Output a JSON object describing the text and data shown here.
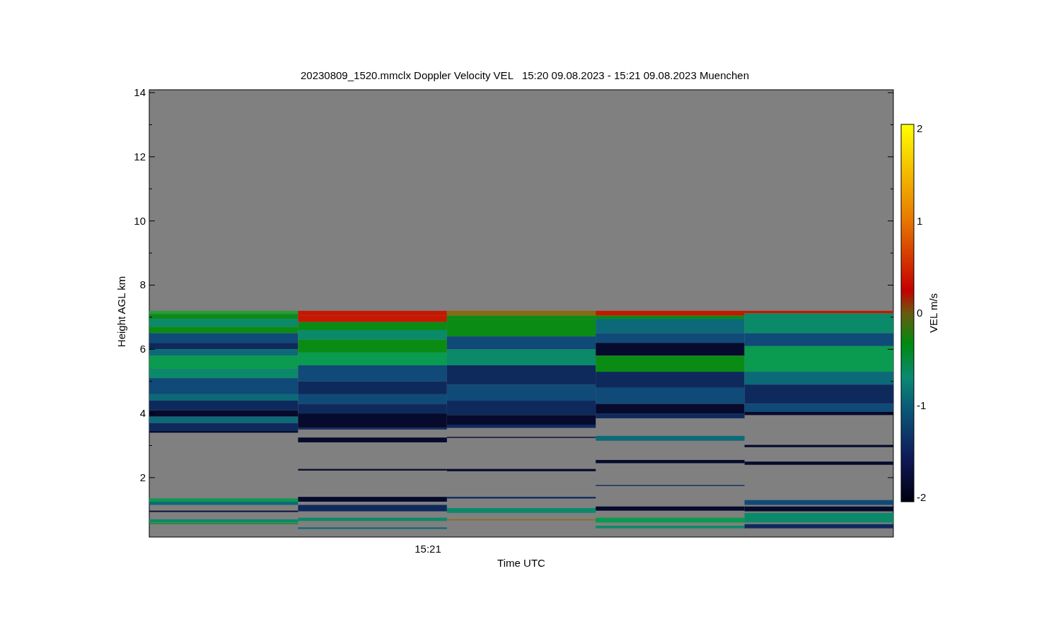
{
  "figure": {
    "title": "20230809_1520.mmclx Doppler Velocity VEL   15:20 09.08.2023 - 15:21 09.08.2023 Muenchen",
    "y_axis": {
      "label": "Height AGL km",
      "ticks": [
        "14",
        "12",
        "10",
        "8",
        "6",
        "4",
        "2"
      ]
    },
    "x_axis": {
      "label": "Time UTC",
      "ticks": [
        "15:21"
      ]
    },
    "colorbar": {
      "label": "VEL m/s",
      "ticks": [
        "2",
        "1",
        "0",
        "-1",
        "-2"
      ]
    }
  }
}
